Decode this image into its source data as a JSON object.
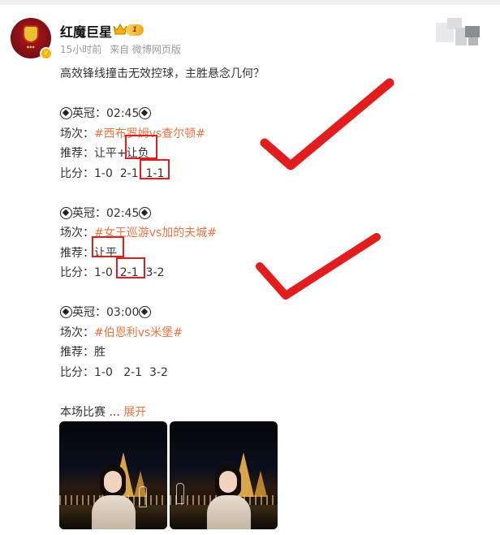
{
  "user": {
    "name": "红魔巨星",
    "level": "1",
    "time": "15小时前",
    "source": "来自 微博网页版"
  },
  "post": {
    "headline": "高效锋线撞击无效控球，主胜悬念几何？",
    "matches": [
      {
        "league": "英冠：02:45",
        "fixture_label": "场次：",
        "fixture": "#西布罗姆vs查尔顿#",
        "pick_label": "推荐：",
        "pick": "让平+让负",
        "score_label": "比分：",
        "scores": "1-0  2-1  1-1"
      },
      {
        "league": "英冠：02:45",
        "fixture_label": "场次：",
        "fixture": "#女王巡游vs加的夫城#",
        "pick_label": "推荐：",
        "pick": "让平",
        "score_label": "比分：",
        "scores": "1-0  2-1  3-2"
      },
      {
        "league": "英冠：03:00",
        "fixture_label": "场次：",
        "fixture": "#伯恩利vs米堡#",
        "pick_label": "推荐：",
        "pick": "胜",
        "score_label": "比分：",
        "scores": "1-0   2-1  3-2"
      }
    ],
    "footer_text": "本场比赛",
    "ellipsis": "...",
    "expand_label": "展开"
  },
  "annotations": {
    "stroke_color": "#e11d1d",
    "checkmarks": 2
  },
  "icons": {
    "league_icon": "soccer-ball-icon",
    "verified": "verified-badge-icon",
    "rank": "crown-icon"
  },
  "colors": {
    "topic": "#eb7340",
    "meta": "#999999",
    "text": "#333333"
  }
}
